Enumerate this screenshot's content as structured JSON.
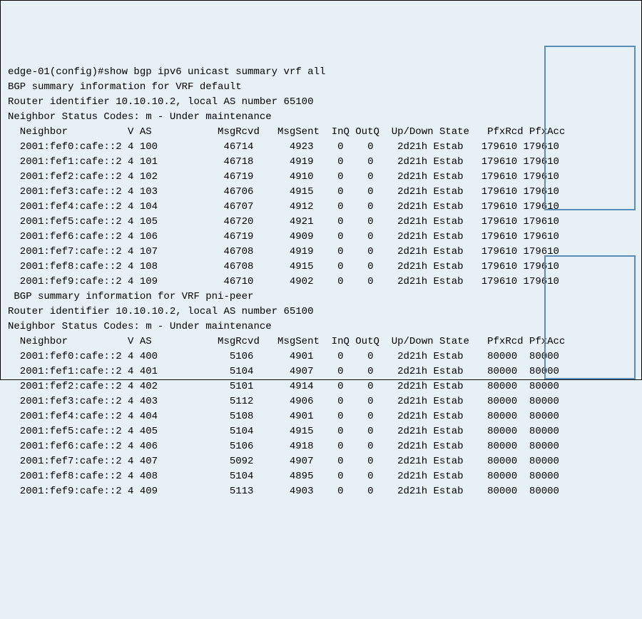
{
  "terminal": {
    "prompt": "edge-01(config)#",
    "command": "show bgp ipv6 unicast summary vrf all",
    "vrfs": [
      {
        "header1": "BGP summary information for VRF default",
        "header2": "Router identifier 10.10.10.2, local AS number 65100",
        "header3": "Neighbor Status Codes: m - Under maintenance",
        "columns": "  Neighbor          V AS           MsgRcvd   MsgSent  InQ OutQ  Up/Down State   PfxRcd PfxAcc",
        "rows": [
          {
            "neighbor": "2001:fef0:cafe::2",
            "v": "4",
            "as": "100",
            "msgRcvd": "46714",
            "msgSent": "4923",
            "inQ": "0",
            "outQ": "0",
            "upDown": "2d21h",
            "state": "Estab",
            "pfxRcd": "179610",
            "pfxAcc": "179610"
          },
          {
            "neighbor": "2001:fef1:cafe::2",
            "v": "4",
            "as": "101",
            "msgRcvd": "46718",
            "msgSent": "4919",
            "inQ": "0",
            "outQ": "0",
            "upDown": "2d21h",
            "state": "Estab",
            "pfxRcd": "179610",
            "pfxAcc": "179610"
          },
          {
            "neighbor": "2001:fef2:cafe::2",
            "v": "4",
            "as": "102",
            "msgRcvd": "46719",
            "msgSent": "4910",
            "inQ": "0",
            "outQ": "0",
            "upDown": "2d21h",
            "state": "Estab",
            "pfxRcd": "179610",
            "pfxAcc": "179610"
          },
          {
            "neighbor": "2001:fef3:cafe::2",
            "v": "4",
            "as": "103",
            "msgRcvd": "46706",
            "msgSent": "4915",
            "inQ": "0",
            "outQ": "0",
            "upDown": "2d21h",
            "state": "Estab",
            "pfxRcd": "179610",
            "pfxAcc": "179610"
          },
          {
            "neighbor": "2001:fef4:cafe::2",
            "v": "4",
            "as": "104",
            "msgRcvd": "46707",
            "msgSent": "4912",
            "inQ": "0",
            "outQ": "0",
            "upDown": "2d21h",
            "state": "Estab",
            "pfxRcd": "179610",
            "pfxAcc": "179610"
          },
          {
            "neighbor": "2001:fef5:cafe::2",
            "v": "4",
            "as": "105",
            "msgRcvd": "46720",
            "msgSent": "4921",
            "inQ": "0",
            "outQ": "0",
            "upDown": "2d21h",
            "state": "Estab",
            "pfxRcd": "179610",
            "pfxAcc": "179610"
          },
          {
            "neighbor": "2001:fef6:cafe::2",
            "v": "4",
            "as": "106",
            "msgRcvd": "46719",
            "msgSent": "4909",
            "inQ": "0",
            "outQ": "0",
            "upDown": "2d21h",
            "state": "Estab",
            "pfxRcd": "179610",
            "pfxAcc": "179610"
          },
          {
            "neighbor": "2001:fef7:cafe::2",
            "v": "4",
            "as": "107",
            "msgRcvd": "46708",
            "msgSent": "4919",
            "inQ": "0",
            "outQ": "0",
            "upDown": "2d21h",
            "state": "Estab",
            "pfxRcd": "179610",
            "pfxAcc": "179610"
          },
          {
            "neighbor": "2001:fef8:cafe::2",
            "v": "4",
            "as": "108",
            "msgRcvd": "46708",
            "msgSent": "4915",
            "inQ": "0",
            "outQ": "0",
            "upDown": "2d21h",
            "state": "Estab",
            "pfxRcd": "179610",
            "pfxAcc": "179610"
          },
          {
            "neighbor": "2001:fef9:cafe::2",
            "v": "4",
            "as": "109",
            "msgRcvd": "46710",
            "msgSent": "4902",
            "inQ": "0",
            "outQ": "0",
            "upDown": "2d21h",
            "state": "Estab",
            "pfxRcd": "179610",
            "pfxAcc": "179610"
          }
        ]
      },
      {
        "header1": " BGP summary information for VRF pni-peer",
        "header2": "Router identifier 10.10.10.2, local AS number 65100",
        "header3": "Neighbor Status Codes: m - Under maintenance",
        "columns": "  Neighbor          V AS           MsgRcvd   MsgSent  InQ OutQ  Up/Down State   PfxRcd PfxAcc",
        "rows": [
          {
            "neighbor": "2001:fef0:cafe::2",
            "v": "4",
            "as": "400",
            "msgRcvd": "5106",
            "msgSent": "4901",
            "inQ": "0",
            "outQ": "0",
            "upDown": "2d21h",
            "state": "Estab",
            "pfxRcd": "80000",
            "pfxAcc": "80000"
          },
          {
            "neighbor": "2001:fef1:cafe::2",
            "v": "4",
            "as": "401",
            "msgRcvd": "5104",
            "msgSent": "4907",
            "inQ": "0",
            "outQ": "0",
            "upDown": "2d21h",
            "state": "Estab",
            "pfxRcd": "80000",
            "pfxAcc": "80000"
          },
          {
            "neighbor": "2001:fef2:cafe::2",
            "v": "4",
            "as": "402",
            "msgRcvd": "5101",
            "msgSent": "4914",
            "inQ": "0",
            "outQ": "0",
            "upDown": "2d21h",
            "state": "Estab",
            "pfxRcd": "80000",
            "pfxAcc": "80000"
          },
          {
            "neighbor": "2001:fef3:cafe::2",
            "v": "4",
            "as": "403",
            "msgRcvd": "5112",
            "msgSent": "4906",
            "inQ": "0",
            "outQ": "0",
            "upDown": "2d21h",
            "state": "Estab",
            "pfxRcd": "80000",
            "pfxAcc": "80000"
          },
          {
            "neighbor": "2001:fef4:cafe::2",
            "v": "4",
            "as": "404",
            "msgRcvd": "5108",
            "msgSent": "4901",
            "inQ": "0",
            "outQ": "0",
            "upDown": "2d21h",
            "state": "Estab",
            "pfxRcd": "80000",
            "pfxAcc": "80000"
          },
          {
            "neighbor": "2001:fef5:cafe::2",
            "v": "4",
            "as": "405",
            "msgRcvd": "5104",
            "msgSent": "4915",
            "inQ": "0",
            "outQ": "0",
            "upDown": "2d21h",
            "state": "Estab",
            "pfxRcd": "80000",
            "pfxAcc": "80000"
          },
          {
            "neighbor": "2001:fef6:cafe::2",
            "v": "4",
            "as": "406",
            "msgRcvd": "5106",
            "msgSent": "4918",
            "inQ": "0",
            "outQ": "0",
            "upDown": "2d21h",
            "state": "Estab",
            "pfxRcd": "80000",
            "pfxAcc": "80000"
          },
          {
            "neighbor": "2001:fef7:cafe::2",
            "v": "4",
            "as": "407",
            "msgRcvd": "5092",
            "msgSent": "4907",
            "inQ": "0",
            "outQ": "0",
            "upDown": "2d21h",
            "state": "Estab",
            "pfxRcd": "80000",
            "pfxAcc": "80000"
          },
          {
            "neighbor": "2001:fef8:cafe::2",
            "v": "4",
            "as": "408",
            "msgRcvd": "5104",
            "msgSent": "4895",
            "inQ": "0",
            "outQ": "0",
            "upDown": "2d21h",
            "state": "Estab",
            "pfxRcd": "80000",
            "pfxAcc": "80000"
          },
          {
            "neighbor": "2001:fef9:cafe::2",
            "v": "4",
            "as": "409",
            "msgRcvd": "5113",
            "msgSent": "4903",
            "inQ": "0",
            "outQ": "0",
            "upDown": "2d21h",
            "state": "Estab",
            "pfxRcd": "80000",
            "pfxAcc": "80000"
          }
        ]
      }
    ]
  }
}
